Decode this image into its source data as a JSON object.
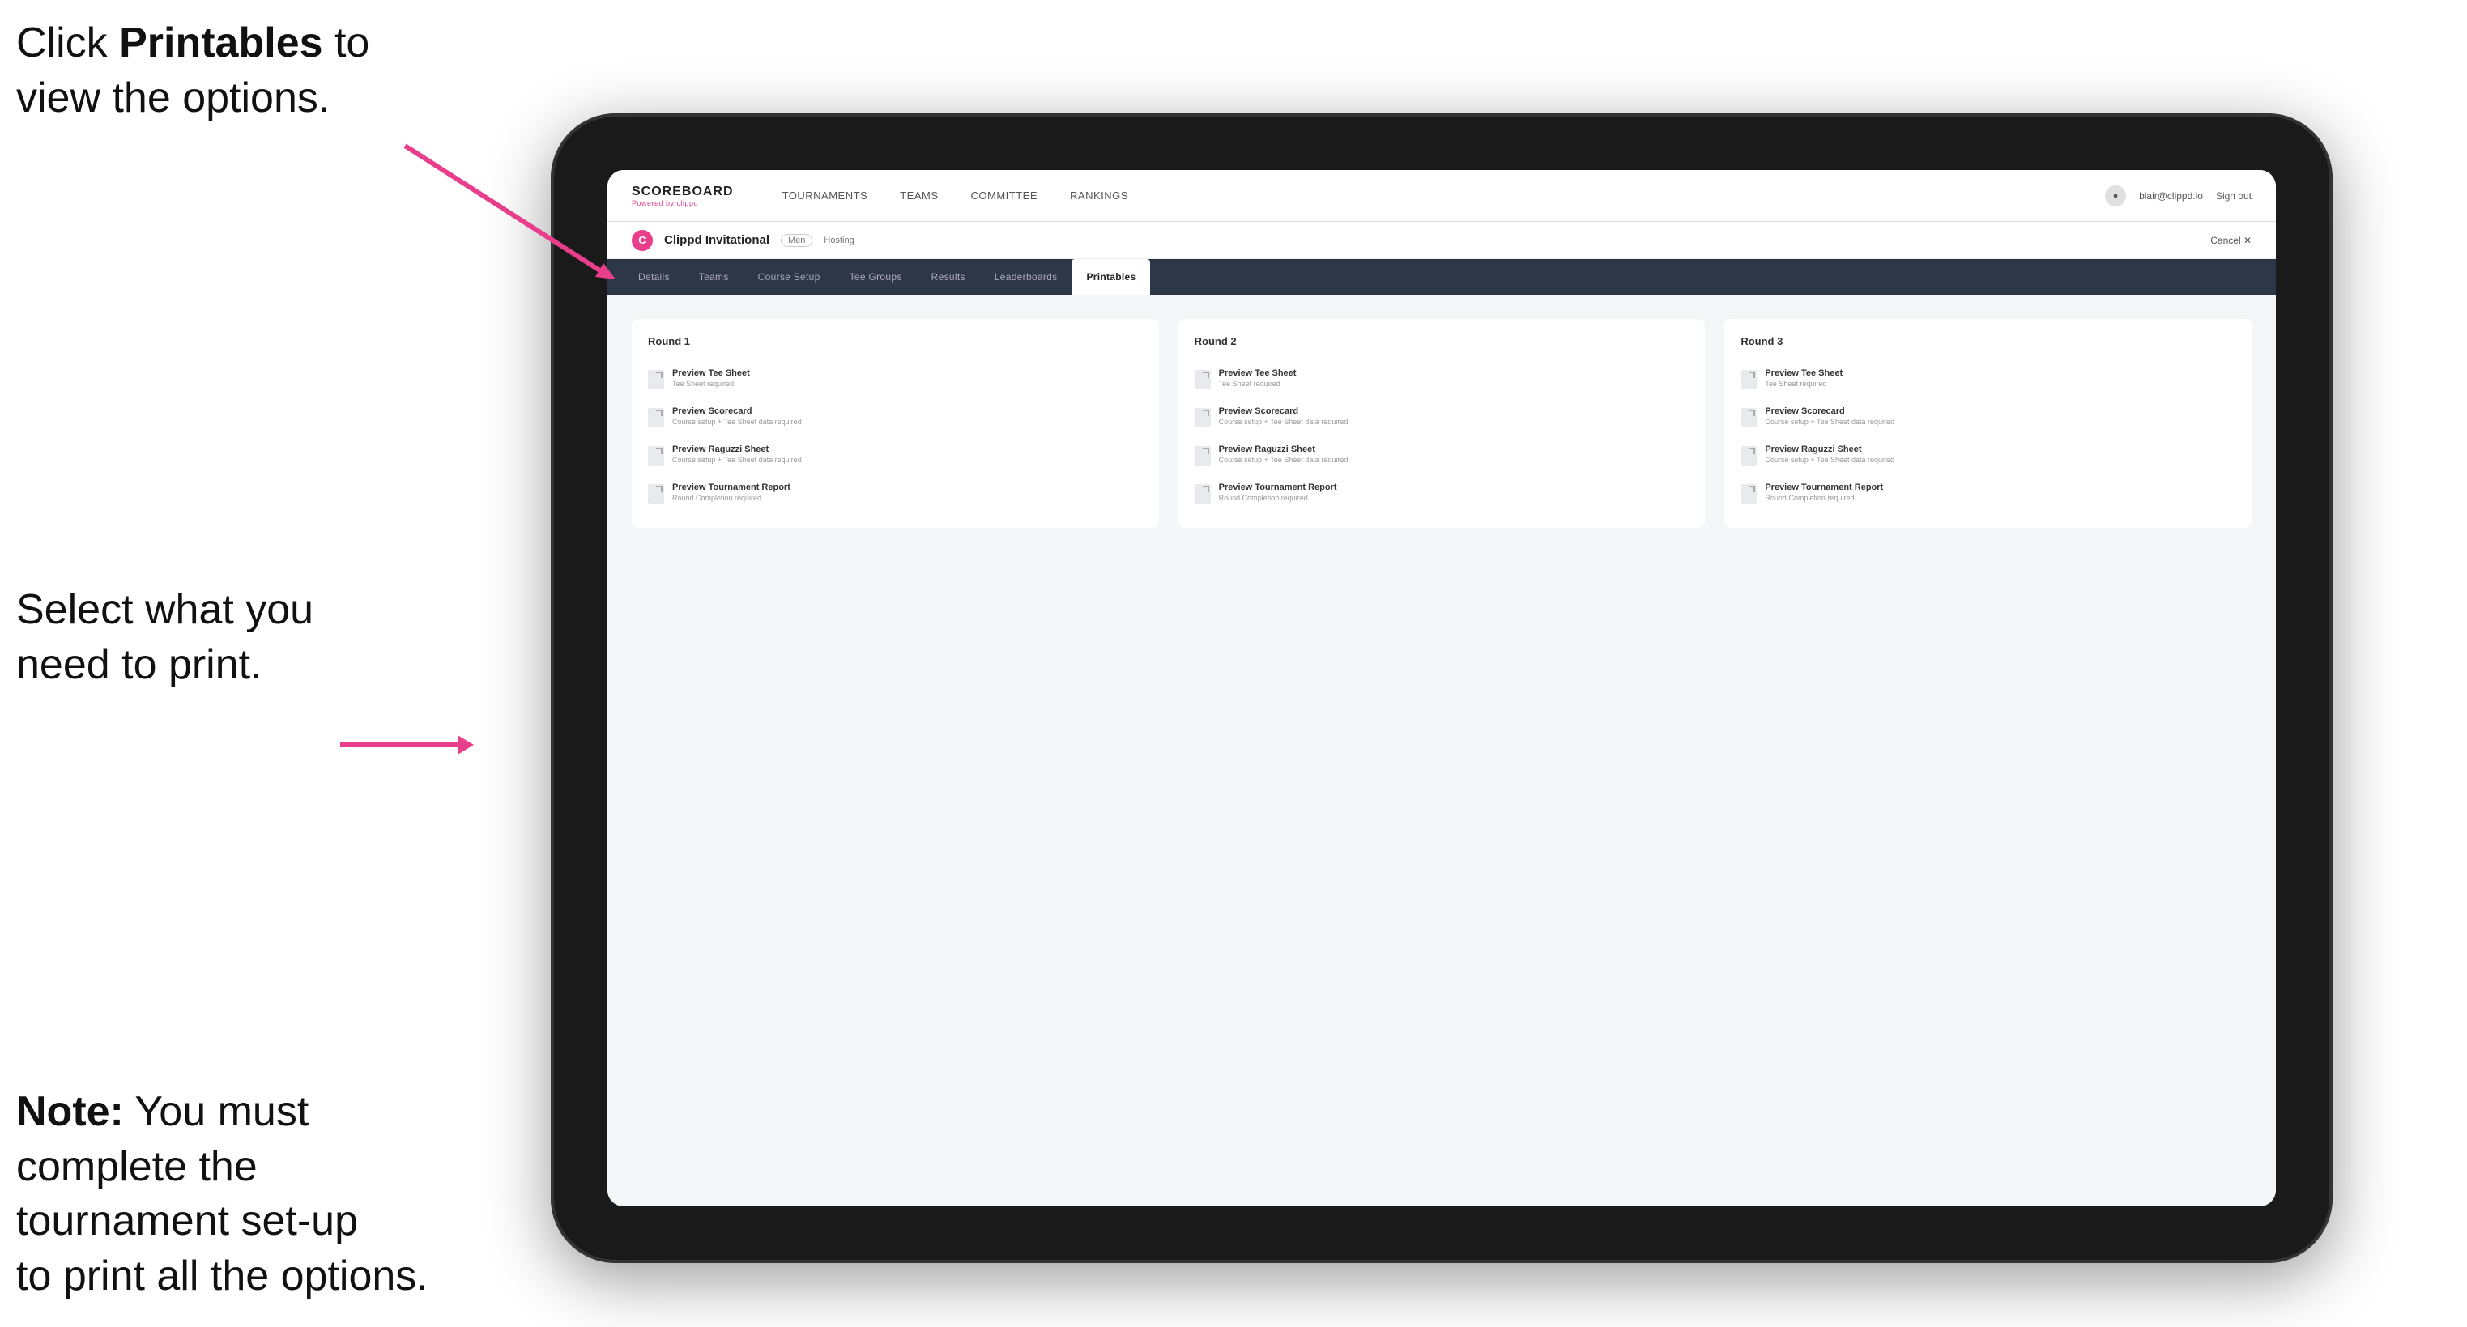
{
  "annotation": {
    "top_line1": "Click ",
    "top_bold": "Printables",
    "top_line2": " to",
    "top_line3": "view the options.",
    "middle_line1": "Select what you",
    "middle_line2": "need to print.",
    "bottom_bold": "Note:",
    "bottom_line1": " You must",
    "bottom_line2": "complete the",
    "bottom_line3": "tournament set-up",
    "bottom_line4": "to print all the options."
  },
  "nav": {
    "logo": "SCOREBOARD",
    "logo_sub": "Powered by clippd",
    "links": [
      {
        "label": "TOURNAMENTS",
        "active": false
      },
      {
        "label": "TEAMS",
        "active": false
      },
      {
        "label": "COMMITTEE",
        "active": false
      },
      {
        "label": "RANKINGS",
        "active": false
      }
    ],
    "user_email": "blair@clippd.io",
    "sign_out": "Sign out"
  },
  "tournament": {
    "logo_letter": "C",
    "name": "Clippd Invitational",
    "badge": "Men",
    "status": "Hosting",
    "cancel": "Cancel ✕"
  },
  "sub_tabs": [
    {
      "label": "Details",
      "active": false
    },
    {
      "label": "Teams",
      "active": false
    },
    {
      "label": "Course Setup",
      "active": false
    },
    {
      "label": "Tee Groups",
      "active": false
    },
    {
      "label": "Results",
      "active": false
    },
    {
      "label": "Leaderboards",
      "active": false
    },
    {
      "label": "Printables",
      "active": true
    }
  ],
  "rounds": [
    {
      "title": "Round 1",
      "items": [
        {
          "title": "Preview Tee Sheet",
          "subtitle": "Tee Sheet required"
        },
        {
          "title": "Preview Scorecard",
          "subtitle": "Course setup + Tee Sheet data required"
        },
        {
          "title": "Preview Raguzzi Sheet",
          "subtitle": "Course setup + Tee Sheet data required"
        },
        {
          "title": "Preview Tournament Report",
          "subtitle": "Round Completion required"
        }
      ]
    },
    {
      "title": "Round 2",
      "items": [
        {
          "title": "Preview Tee Sheet",
          "subtitle": "Tee Sheet required"
        },
        {
          "title": "Preview Scorecard",
          "subtitle": "Course setup + Tee Sheet data required"
        },
        {
          "title": "Preview Raguzzi Sheet",
          "subtitle": "Course setup + Tee Sheet data required"
        },
        {
          "title": "Preview Tournament Report",
          "subtitle": "Round Completion required"
        }
      ]
    },
    {
      "title": "Round 3",
      "items": [
        {
          "title": "Preview Tee Sheet",
          "subtitle": "Tee Sheet required"
        },
        {
          "title": "Preview Scorecard",
          "subtitle": "Course setup + Tee Sheet data required"
        },
        {
          "title": "Preview Raguzzi Sheet",
          "subtitle": "Course setup + Tee Sheet data required"
        },
        {
          "title": "Preview Tournament Report",
          "subtitle": "Round Completion required"
        }
      ]
    }
  ]
}
